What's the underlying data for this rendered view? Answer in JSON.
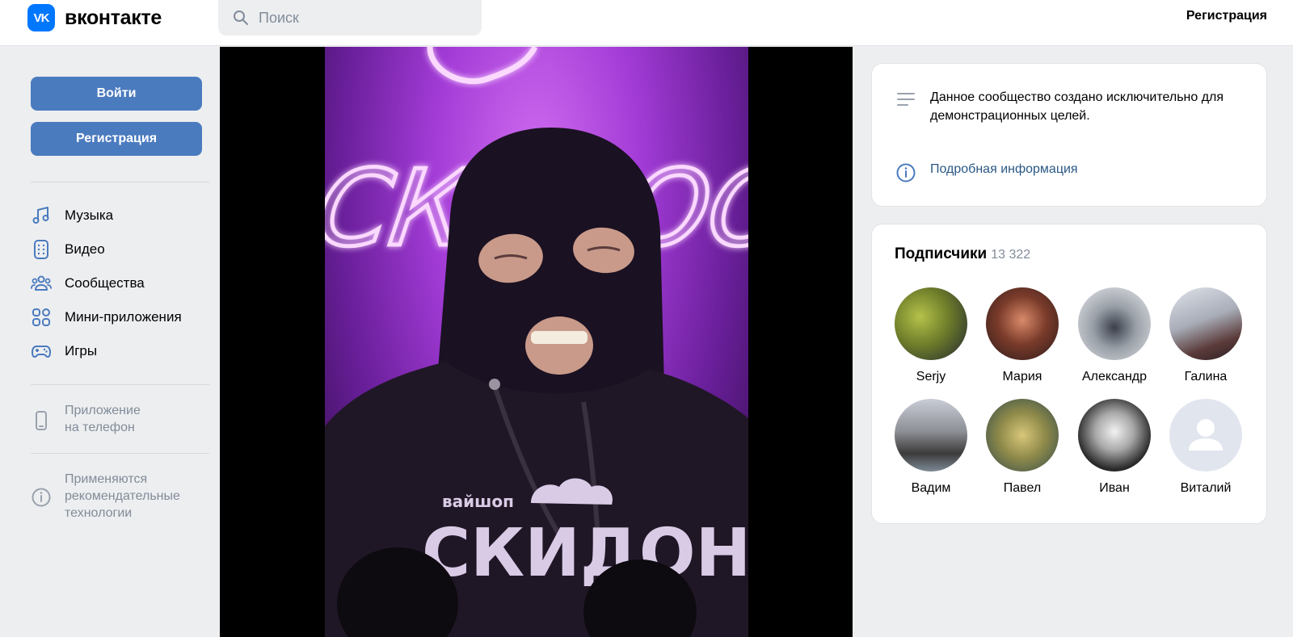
{
  "header": {
    "logo_mark": "VK",
    "logo_text": "вконтакте",
    "search_placeholder": "Поиск",
    "register_link": "Регистрация"
  },
  "sidebar": {
    "login_button": "Войти",
    "register_button": "Регистрация",
    "nav": [
      {
        "label": "Музыка",
        "icon": "music-icon"
      },
      {
        "label": "Видео",
        "icon": "video-icon"
      },
      {
        "label": "Сообщества",
        "icon": "communities-icon"
      },
      {
        "label": "Мини-приложения",
        "icon": "mini-apps-icon"
      },
      {
        "label": "Игры",
        "icon": "gamepad-icon"
      }
    ],
    "app_note": [
      "Приложение",
      "на телефон"
    ],
    "rec_note": [
      "Применяются",
      "рекомендательные",
      "технологии"
    ]
  },
  "video": {
    "neon_sign": "СКИДОО",
    "hoodie_small": "вайшоп",
    "hoodie_big": "СКИДОН"
  },
  "info_card": {
    "description": "Данное сообщество создано исключительно для демонстрационных целей.",
    "more_link": "Подробная информация"
  },
  "subscribers": {
    "title": "Подписчики",
    "count": "13 322",
    "people": [
      {
        "name": "Serjy"
      },
      {
        "name": "Мария"
      },
      {
        "name": "Александр"
      },
      {
        "name": "Галина"
      },
      {
        "name": "Вадим"
      },
      {
        "name": "Павел"
      },
      {
        "name": "Иван"
      },
      {
        "name": "Виталий"
      }
    ]
  },
  "colors": {
    "accent": "#4b7bbf",
    "brand": "#0077ff",
    "link": "#2a5885",
    "page_bg": "#edeef0"
  }
}
